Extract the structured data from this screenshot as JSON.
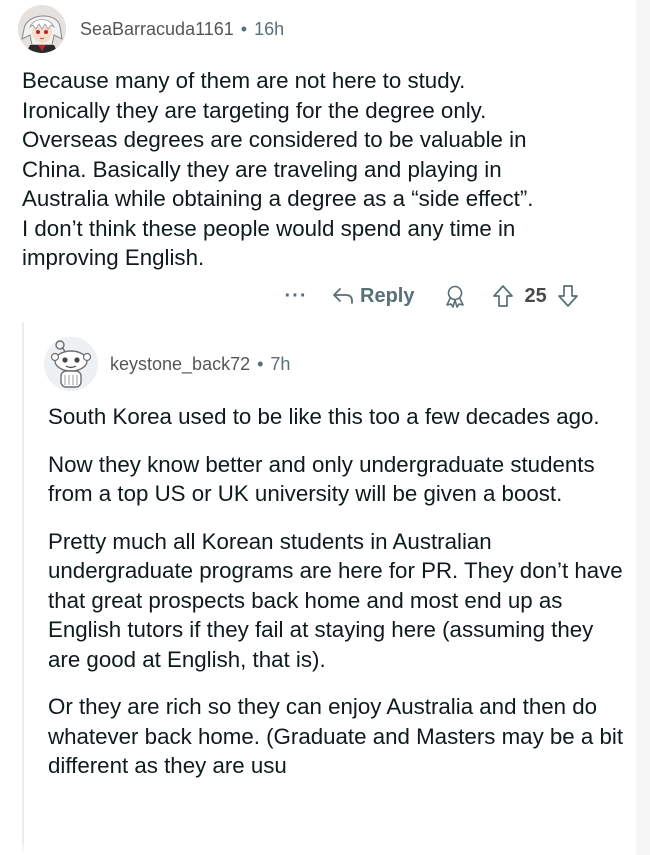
{
  "comment": {
    "username": "SeaBarracuda1161",
    "separator": "•",
    "age": "16h",
    "lines": [
      "Because many of them are not here to study.",
      "Ironically they are targeting for the degree only.",
      "Overseas degrees are considered to be valuable in",
      "China. Basically they are traveling and playing in",
      "Australia while obtaining a degree as a “side effect”.",
      "I don’t think these people would spend any time in",
      "improving English."
    ],
    "actions": {
      "more_label": "···",
      "reply_label": "Reply",
      "vote_count": "25"
    }
  },
  "reply": {
    "username": "keystone_back72",
    "separator": "•",
    "age": "7h",
    "paragraphs": [
      "South Korea used to be like this too a few decades ago.",
      "Now they know better and only undergraduate students from a top US or UK university will be given a boost.",
      "Pretty much all Korean students in Australian undergraduate programs are here for PR. They don’t have that great prospects back home and most end up as English tutors if they fail at staying here (assuming they are good at English, that is).",
      "Or they are rich so they can enjoy Australia and then do whatever back home. (Graduate and Masters may be a bit different as they are usu"
    ]
  },
  "colors": {
    "meta": "#576f76",
    "text": "#0f1a1c",
    "thread_line": "#ececec"
  }
}
